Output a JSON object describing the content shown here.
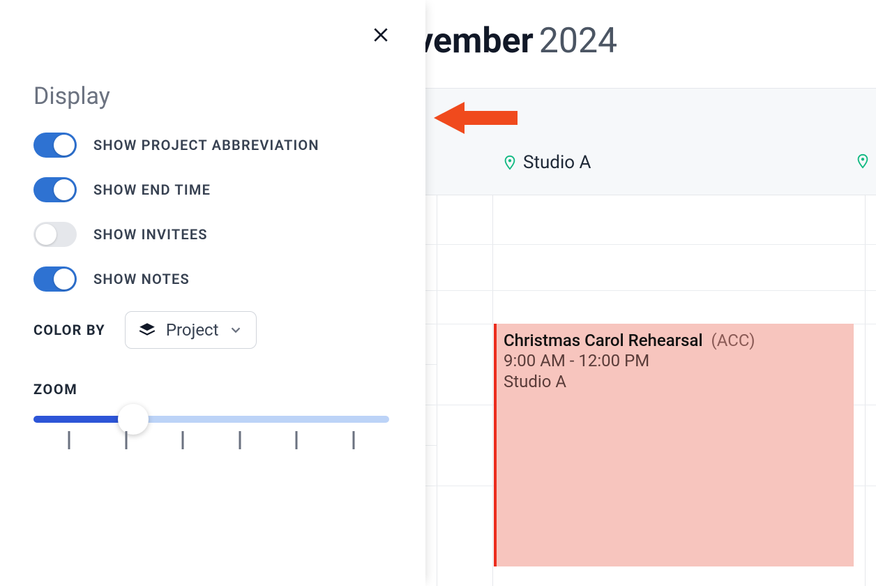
{
  "panel": {
    "title": "Display",
    "toggles": [
      {
        "label": "SHOW PROJECT ABBREVIATION",
        "on": true
      },
      {
        "label": "SHOW END TIME",
        "on": true
      },
      {
        "label": "SHOW INVITEES",
        "on": false
      },
      {
        "label": "SHOW NOTES",
        "on": true
      }
    ],
    "color_by": {
      "label": "COLOR BY",
      "value": "Project"
    },
    "zoom": {
      "label": "ZOOM",
      "percent": 28,
      "ticks": 6
    }
  },
  "calendar": {
    "month_partial": "vember",
    "year": "2024",
    "location": "Studio A",
    "event": {
      "title": "Christmas Carol Rehearsal",
      "abbrev": "(ACC)",
      "time": "9:00 AM - 12:00 PM",
      "location": "Studio A"
    }
  }
}
